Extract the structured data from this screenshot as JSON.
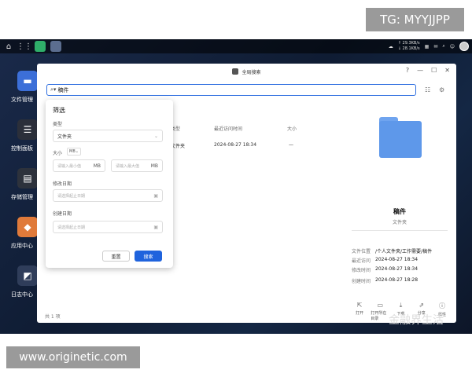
{
  "watermarks": {
    "top": "TG: MYYJJPP",
    "bottom_left": "www.originetic.com",
    "bottom_right": "金融界生活"
  },
  "topbar": {
    "net_up": "↑ 29.3KB/s",
    "net_down": "↓ 28.1KB/s"
  },
  "desktop_icons": [
    {
      "label": "文件管理",
      "color": "#3c6fd8",
      "glyph": "folder"
    },
    {
      "label": "控制面板",
      "color": "#2b2f3a",
      "glyph": "sliders"
    },
    {
      "label": "存储管理",
      "color": "#2d323c",
      "glyph": "disk"
    },
    {
      "label": "应用中心",
      "color": "#e07a3a",
      "glyph": "apps"
    },
    {
      "label": "日志中心",
      "color": "#2f3d5a",
      "glyph": "log"
    }
  ],
  "window": {
    "title": "全局搜索",
    "search_value": "稿件",
    "status": "共 1 项",
    "columns": {
      "type": "类型",
      "modified": "最近访问时间",
      "size": "大小"
    },
    "result": {
      "type": "文件夹",
      "time": "2024-08-27 18:34",
      "size": "—"
    }
  },
  "preview": {
    "name": "稿件",
    "type": "文件夹",
    "location_label": "文件位置",
    "location_value": "/个人文件夹/工作需要/稿件",
    "access_label": "最近访问",
    "access_value": "2024-08-27 18:34",
    "modified_label": "修改时间",
    "modified_value": "2024-08-27 18:34",
    "created_label": "创建时间",
    "created_value": "2024-08-27 18:28",
    "actions": [
      "打开",
      "打开所在目录",
      "下载",
      "分享",
      "属性"
    ]
  },
  "filter": {
    "title": "筛选",
    "type_label": "类型",
    "type_value": "文件夹",
    "size_label": "大小",
    "size_unit": "MB",
    "min_placeholder": "请输入最小值",
    "max_placeholder": "请输入最大值",
    "modified_label": "修改日期",
    "modified_placeholder": "请选择起止日期",
    "created_label": "创建日期",
    "created_placeholder": "请选择起止日期",
    "reset": "重置",
    "search": "搜索"
  }
}
